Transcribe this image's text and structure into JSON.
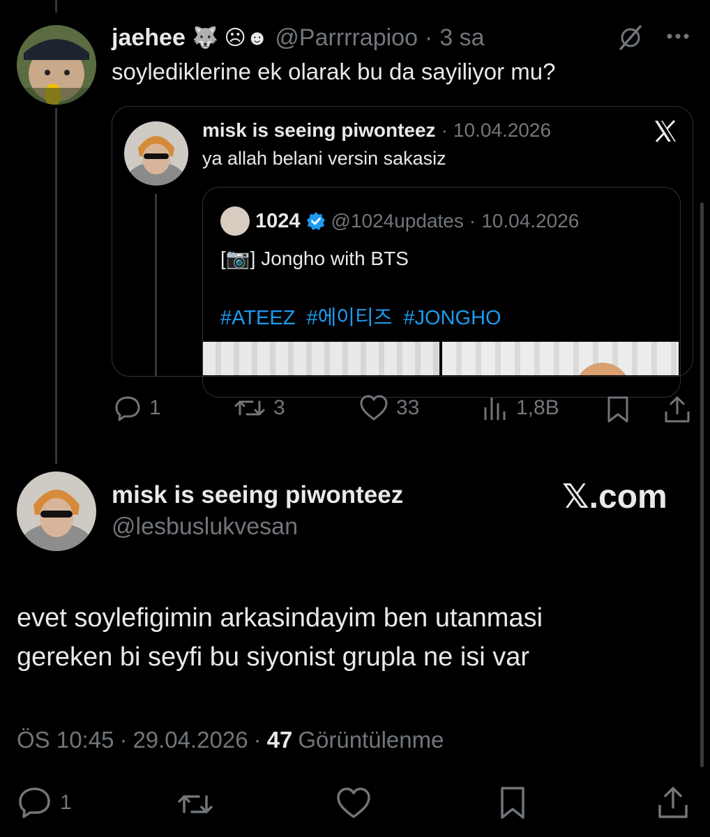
{
  "reply": {
    "name": "jaehee",
    "emoji": "🐺 ☹☻",
    "handle": "@Parrrrapioo",
    "dot": "·",
    "time": "3 sa",
    "text": "soylediklerine ek olarak bu da sayiliyor mu?"
  },
  "quote": {
    "name": "misk is seeing piwonteez",
    "dot": "·",
    "date": "10.04.2026",
    "text": "ya allah belani versin sakasiz",
    "inner": {
      "name": "1024",
      "handle": "@1024updates",
      "dot": "·",
      "date": "10.04.2026",
      "text_prefix": "[",
      "camera": "📷",
      "text_suffix": "] Jongho with BTS",
      "hashtags": [
        "#ATEEZ",
        "#에이티즈",
        "#JONGHO"
      ]
    }
  },
  "reply_actions": {
    "replies": "1",
    "retweets": "3",
    "likes": "33",
    "views": "1,8B"
  },
  "main": {
    "name": "misk is seeing piwonteez",
    "handle": "@lesbuslukvesan",
    "brand": "𝕏.com",
    "text_line1": "evet soylefigimin arkasindayim ben utanmasi",
    "text_line2": "gereken bi seyfi bu siyonist grupla ne isi var",
    "time": "ÖS 10:45",
    "dot1": "·",
    "date": "29.04.2026",
    "dot2": "·",
    "views": "47",
    "views_label": "Görüntülenme"
  },
  "bottom_actions": {
    "replies": "1"
  },
  "colors": {
    "background": "#000000",
    "text": "#e7e9ea",
    "muted": "#71767b",
    "accent": "#1d9bf0",
    "border": "#2f3336"
  }
}
